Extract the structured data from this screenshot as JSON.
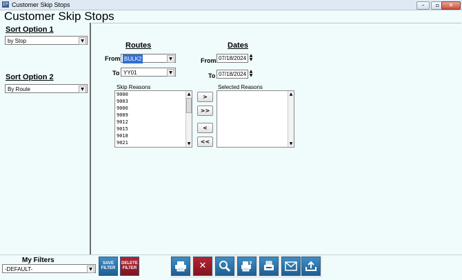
{
  "window": {
    "title": "Customer Skip Stops",
    "app_icon": "EP"
  },
  "page": {
    "heading": "Customer Skip Stops"
  },
  "sort_option_1": {
    "label": "Sort Option 1",
    "value": "by Stop"
  },
  "sort_option_2": {
    "label": "Sort Option 2",
    "value": "By Route"
  },
  "routes": {
    "title": "Routes",
    "from_label": "From",
    "from_value": "BULK2",
    "to_label": "To",
    "to_value": "YY01"
  },
  "dates": {
    "title": "Dates",
    "from_label": "From",
    "from_value": "07/18/2024",
    "to_label": "To",
    "to_value": "07/18/2024"
  },
  "skip_reasons": {
    "label": "Skip Reasons",
    "items": [
      "9000",
      "9003",
      "9006",
      "9009",
      "9012",
      "9015",
      "9018",
      "9021"
    ]
  },
  "selected_reasons": {
    "label": "Selected Reasons",
    "items": []
  },
  "move_buttons": {
    "add": ">",
    "add_all": ">>",
    "remove": "<",
    "remove_all": "<<"
  },
  "filters": {
    "label": "My Filters",
    "value": "-DEFAULT-",
    "save_label": "SAVE FILTER",
    "delete_label": "DELETE FILTER"
  },
  "colors": {
    "accent_blue": "#2f6fd3",
    "toolbar_blue": "#1f5e92",
    "toolbar_red": "#7e1520"
  }
}
